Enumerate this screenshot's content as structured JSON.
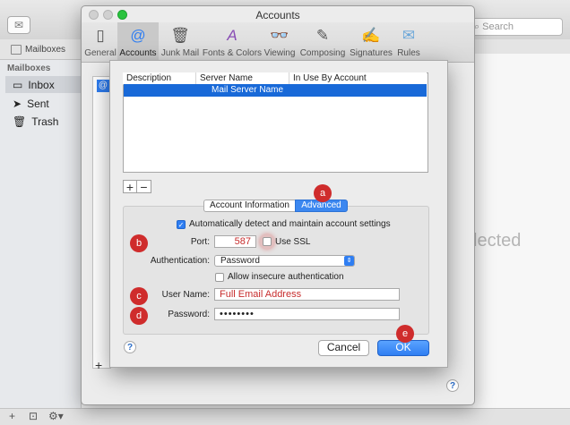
{
  "mail": {
    "search_placeholder": "Search",
    "favorites_label": "Mailboxes",
    "sidebar_header": "Mailboxes",
    "sidebar_items": [
      "Inbox",
      "Sent",
      "Trash"
    ],
    "no_selection_fragment": "lected"
  },
  "prefs": {
    "title": "Accounts",
    "tabs": [
      "General",
      "Accounts",
      "Junk Mail",
      "Fonts & Colors",
      "Viewing",
      "Composing",
      "Signatures",
      "Rules"
    ]
  },
  "server_list": {
    "columns": [
      "Description",
      "Server Name",
      "In Use By Account"
    ],
    "rows": [
      {
        "description": "",
        "server_name": "Mail Server Name",
        "in_use": ""
      }
    ]
  },
  "settings": {
    "segments": [
      "Account Information",
      "Advanced"
    ],
    "auto_detect_label": "Automatically detect and maintain account settings",
    "port_label": "Port:",
    "port_value": "587",
    "ssl_label": "Use SSL",
    "auth_label": "Authentication:",
    "auth_value": "Password",
    "insecure_label": "Allow insecure authentication",
    "username_label": "User Name:",
    "username_value": "Full Email Address",
    "password_label": "Password:",
    "password_value": "••••••••"
  },
  "buttons": {
    "cancel": "Cancel",
    "ok": "OK",
    "help": "?"
  },
  "badges": [
    "a",
    "b",
    "c",
    "d",
    "e"
  ],
  "colors": {
    "accent": "#2f7ef2",
    "selection": "#1869d8",
    "badge": "#cf2c2c",
    "annotation_text": "#c72d2d"
  }
}
